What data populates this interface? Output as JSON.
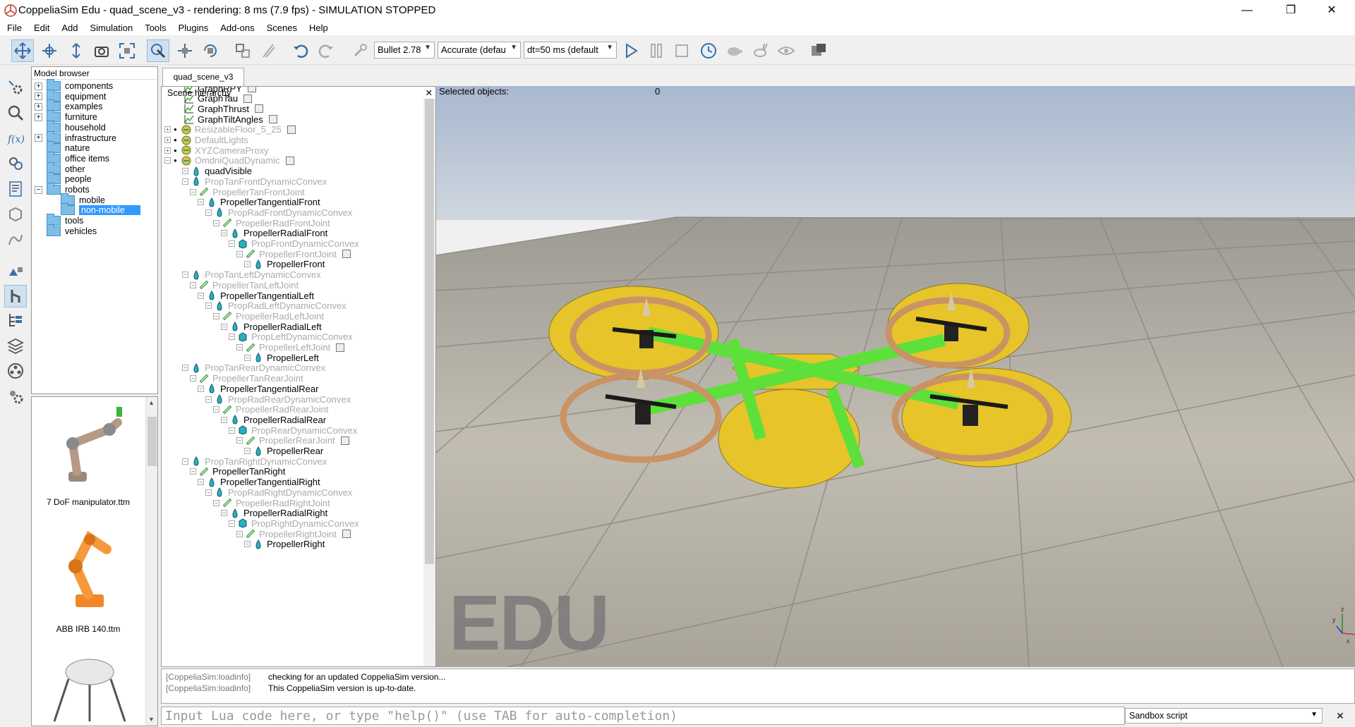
{
  "window": {
    "title": "CoppeliaSim Edu - quad_scene_v3 - rendering: 8 ms (7.9 fps) - SIMULATION STOPPED",
    "minimize": "—",
    "maximize": "❐",
    "close": "✕"
  },
  "menu": [
    "File",
    "Edit",
    "Add",
    "Simulation",
    "Tools",
    "Plugins",
    "Add-ons",
    "Scenes",
    "Help"
  ],
  "toolbar": {
    "engine": "Bullet 2.78",
    "accuracy": "Accurate (defau",
    "timestep": "dt=50 ms (default"
  },
  "model_browser": {
    "header": "Model browser",
    "items": [
      {
        "label": "components",
        "expandable": true
      },
      {
        "label": "equipment",
        "expandable": true
      },
      {
        "label": "examples",
        "expandable": true
      },
      {
        "label": "furniture",
        "expandable": true
      },
      {
        "label": "household",
        "expandable": false
      },
      {
        "label": "infrastructure",
        "expandable": true
      },
      {
        "label": "nature",
        "expandable": false
      },
      {
        "label": "office items",
        "expandable": false
      },
      {
        "label": "other",
        "expandable": false
      },
      {
        "label": "people",
        "expandable": false
      },
      {
        "label": "robots",
        "expandable": true,
        "expanded": true
      },
      {
        "label": "mobile",
        "expandable": false
      },
      {
        "label": "non-mobile",
        "expandable": false,
        "selected": true
      },
      {
        "label": "tools",
        "expandable": false
      },
      {
        "label": "vehicles",
        "expandable": false
      }
    ],
    "thumbnails": [
      "7 DoF manipulator.ttm",
      "ABB IRB 140.ttm"
    ]
  },
  "scene_tab": "quad_scene_v3",
  "hierarchy": {
    "header": "Scene hierarchy",
    "close": "✕",
    "rows": [
      {
        "label": "GraphRPY",
        "type": "graph",
        "dim": false
      },
      {
        "label": "GraphTau",
        "type": "graph",
        "dim": false
      },
      {
        "label": "GraphThrust",
        "type": "graph",
        "dim": false
      },
      {
        "label": "GraphTiltAngles",
        "type": "graph",
        "dim": false
      },
      {
        "label": "ResizableFloor_5_25",
        "type": "model",
        "dim": true
      },
      {
        "label": "DefaultLights",
        "type": "model",
        "dim": true
      },
      {
        "label": "XYZCameraProxy",
        "type": "model",
        "dim": true
      },
      {
        "label": "OmdniQuadDynamic",
        "type": "model",
        "dim": true
      },
      {
        "label": "quadVisible",
        "type": "shape",
        "dim": false
      },
      {
        "label": "PropTanFrontDynamicConvex",
        "type": "shape",
        "dim": true
      },
      {
        "label": "PropellerTanFrontJoint",
        "type": "joint",
        "dim": true
      },
      {
        "label": "PropellerTangentialFront",
        "type": "shape",
        "dim": false
      },
      {
        "label": "PropRadFrontDynamicConvex",
        "type": "shape",
        "dim": true
      },
      {
        "label": "PropellerRadFrontJoint",
        "type": "joint",
        "dim": true
      },
      {
        "label": "PropellerRadialFront",
        "type": "shape",
        "dim": false
      },
      {
        "label": "PropFrontDynamicConvex",
        "type": "cube",
        "dim": true
      },
      {
        "label": "PropellerFrontJoint",
        "type": "joint",
        "dim": true
      },
      {
        "label": "PropellerFront",
        "type": "shape",
        "dim": false
      },
      {
        "label": "PropTanLeftDynamicConvex",
        "type": "shape",
        "dim": true
      },
      {
        "label": "PropellerTanLeftJoint",
        "type": "joint",
        "dim": true
      },
      {
        "label": "PropellerTangentialLeft",
        "type": "shape",
        "dim": false
      },
      {
        "label": "PropRadLeftDynamicConvex",
        "type": "shape",
        "dim": true
      },
      {
        "label": "PropellerRadLeftJoint",
        "type": "joint",
        "dim": true
      },
      {
        "label": "PropellerRadialLeft",
        "type": "shape",
        "dim": false
      },
      {
        "label": "PropLeftDynamicConvex",
        "type": "cube",
        "dim": true
      },
      {
        "label": "PropellerLeftJoint",
        "type": "joint",
        "dim": true
      },
      {
        "label": "PropellerLeft",
        "type": "shape",
        "dim": false
      },
      {
        "label": "PropTanRearDynamicConvex",
        "type": "shape",
        "dim": true
      },
      {
        "label": "PropellerTanRearJoint",
        "type": "joint",
        "dim": true
      },
      {
        "label": "PropellerTangentialRear",
        "type": "shape",
        "dim": false
      },
      {
        "label": "PropRadRearDynamicConvex",
        "type": "shape",
        "dim": true
      },
      {
        "label": "PropellerRadRearJoint",
        "type": "joint",
        "dim": true
      },
      {
        "label": "PropellerRadialRear",
        "type": "shape",
        "dim": false
      },
      {
        "label": "PropRearDynamicConvex",
        "type": "cube",
        "dim": true
      },
      {
        "label": "PropellerRearJoint",
        "type": "joint",
        "dim": true
      },
      {
        "label": "PropellerRear",
        "type": "shape",
        "dim": false
      },
      {
        "label": "PropTanRightDynamicConvex",
        "type": "shape",
        "dim": true
      },
      {
        "label": "PropellerTanRight",
        "type": "joint",
        "dim": false
      },
      {
        "label": "PropellerTangentialRight",
        "type": "shape",
        "dim": false
      },
      {
        "label": "PropRadRightDynamicConvex",
        "type": "shape",
        "dim": true
      },
      {
        "label": "PropellerRadRightJoint",
        "type": "joint",
        "dim": true
      },
      {
        "label": "PropellerRadialRight",
        "type": "shape",
        "dim": false
      },
      {
        "label": "PropRightDynamicConvex",
        "type": "cube",
        "dim": true
      },
      {
        "label": "PropellerRightJoint",
        "type": "joint",
        "dim": true
      },
      {
        "label": "PropellerRight",
        "type": "shape",
        "dim": false
      }
    ]
  },
  "viewport": {
    "selected_label": "Selected objects:",
    "selected_count": "0",
    "watermark": "EDU",
    "axis_x": "x",
    "axis_y": "y",
    "axis_z": "z"
  },
  "console": {
    "lines": [
      {
        "source": "[CoppeliaSim:loadinfo]",
        "text": "checking for an updated CoppeliaSim version..."
      },
      {
        "source": "[CoppeliaSim:loadinfo]",
        "text": "This CoppeliaSim version is up-to-date."
      }
    ]
  },
  "lua_input": {
    "placeholder": "Input Lua code here, or type \"help()\" (use TAB for auto-completion)"
  },
  "script_select": {
    "value": "Sandbox script",
    "close": "✕"
  },
  "colors": {
    "accent": "#3399ff",
    "frame_yellow": "#e6c42a",
    "frame_green": "#5ee03a",
    "ring_wood": "#c99366",
    "floor": "#b8b3a8"
  }
}
